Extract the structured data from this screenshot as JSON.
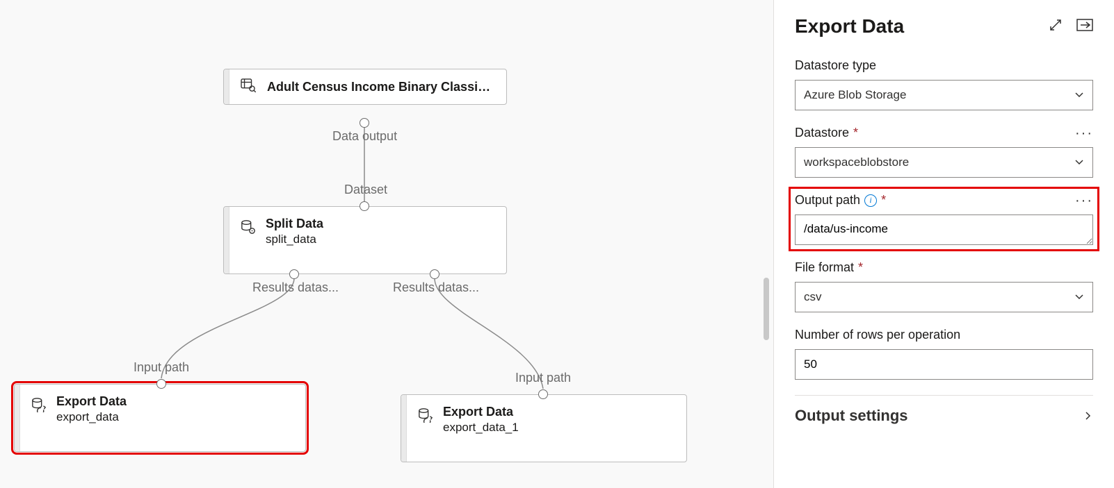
{
  "canvas": {
    "nodes": {
      "dataset": {
        "title": "Adult Census Income Binary Classificatio...",
        "out_port_label": "Data output"
      },
      "split": {
        "title": "Split Data",
        "subtitle": "split_data",
        "in_port_label": "Dataset",
        "out_port_left_label": "Results datas...",
        "out_port_right_label": "Results datas..."
      },
      "export1": {
        "title": "Export Data",
        "subtitle": "export_data",
        "in_port_label": "Input path"
      },
      "export2": {
        "title": "Export Data",
        "subtitle": "export_data_1",
        "in_port_label": "Input path"
      }
    }
  },
  "panel": {
    "title": "Export Data",
    "fields": {
      "datastore_type": {
        "label": "Datastore type",
        "value": "Azure Blob Storage"
      },
      "datastore": {
        "label": "Datastore",
        "value": "workspaceblobstore"
      },
      "output_path": {
        "label": "Output path",
        "value": "/data/us-income"
      },
      "file_format": {
        "label": "File format",
        "value": "csv"
      },
      "rows_per_op": {
        "label": "Number of rows per operation",
        "value": "50"
      }
    },
    "output_settings_label": "Output settings"
  }
}
